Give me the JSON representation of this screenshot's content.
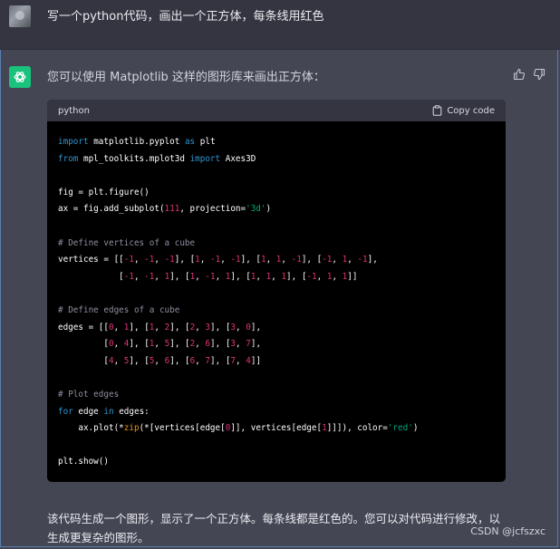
{
  "user_message": "写一个python代码，画出一个正方体，每条线用红色",
  "assistant": {
    "intro": "您可以使用 Matplotlib 这样的图形库来画出正方体：",
    "code_language": "python",
    "copy_label": "Copy code",
    "code_lines": [
      [
        {
          "t": "import",
          "c": "kw"
        },
        {
          "t": " matplotlib.pyplot "
        },
        {
          "t": "as",
          "c": "kw"
        },
        {
          "t": " plt"
        }
      ],
      [
        {
          "t": "from",
          "c": "kw"
        },
        {
          "t": " mpl_toolkits.mplot3d "
        },
        {
          "t": "import",
          "c": "kw"
        },
        {
          "t": " Axes3D"
        }
      ],
      [],
      [
        {
          "t": "fig = plt.figure()"
        }
      ],
      [
        {
          "t": "ax = fig.add_subplot("
        },
        {
          "t": "111",
          "c": "num"
        },
        {
          "t": ", projection="
        },
        {
          "t": "'3d'",
          "c": "str"
        },
        {
          "t": ")"
        }
      ],
      [],
      [
        {
          "t": "# Define vertices of a cube",
          "c": "cm"
        }
      ],
      [
        {
          "t": "vertices = [["
        },
        {
          "t": "-1",
          "c": "num"
        },
        {
          "t": ", "
        },
        {
          "t": "-1",
          "c": "num"
        },
        {
          "t": ", "
        },
        {
          "t": "-1",
          "c": "num"
        },
        {
          "t": "], ["
        },
        {
          "t": "1",
          "c": "num"
        },
        {
          "t": ", "
        },
        {
          "t": "-1",
          "c": "num"
        },
        {
          "t": ", "
        },
        {
          "t": "-1",
          "c": "num"
        },
        {
          "t": "], ["
        },
        {
          "t": "1",
          "c": "num"
        },
        {
          "t": ", "
        },
        {
          "t": "1",
          "c": "num"
        },
        {
          "t": ", "
        },
        {
          "t": "-1",
          "c": "num"
        },
        {
          "t": "], ["
        },
        {
          "t": "-1",
          "c": "num"
        },
        {
          "t": ", "
        },
        {
          "t": "1",
          "c": "num"
        },
        {
          "t": ", "
        },
        {
          "t": "-1",
          "c": "num"
        },
        {
          "t": "],"
        }
      ],
      [
        {
          "t": "            ["
        },
        {
          "t": "-1",
          "c": "num"
        },
        {
          "t": ", "
        },
        {
          "t": "-1",
          "c": "num"
        },
        {
          "t": ", "
        },
        {
          "t": "1",
          "c": "num"
        },
        {
          "t": "], ["
        },
        {
          "t": "1",
          "c": "num"
        },
        {
          "t": ", "
        },
        {
          "t": "-1",
          "c": "num"
        },
        {
          "t": ", "
        },
        {
          "t": "1",
          "c": "num"
        },
        {
          "t": "], ["
        },
        {
          "t": "1",
          "c": "num"
        },
        {
          "t": ", "
        },
        {
          "t": "1",
          "c": "num"
        },
        {
          "t": ", "
        },
        {
          "t": "1",
          "c": "num"
        },
        {
          "t": "], ["
        },
        {
          "t": "-1",
          "c": "num"
        },
        {
          "t": ", "
        },
        {
          "t": "1",
          "c": "num"
        },
        {
          "t": ", "
        },
        {
          "t": "1",
          "c": "num"
        },
        {
          "t": "]]"
        }
      ],
      [],
      [
        {
          "t": "# Define edges of a cube",
          "c": "cm"
        }
      ],
      [
        {
          "t": "edges = [["
        },
        {
          "t": "0",
          "c": "num"
        },
        {
          "t": ", "
        },
        {
          "t": "1",
          "c": "num"
        },
        {
          "t": "], ["
        },
        {
          "t": "1",
          "c": "num"
        },
        {
          "t": ", "
        },
        {
          "t": "2",
          "c": "num"
        },
        {
          "t": "], ["
        },
        {
          "t": "2",
          "c": "num"
        },
        {
          "t": ", "
        },
        {
          "t": "3",
          "c": "num"
        },
        {
          "t": "], ["
        },
        {
          "t": "3",
          "c": "num"
        },
        {
          "t": ", "
        },
        {
          "t": "0",
          "c": "num"
        },
        {
          "t": "],"
        }
      ],
      [
        {
          "t": "         ["
        },
        {
          "t": "0",
          "c": "num"
        },
        {
          "t": ", "
        },
        {
          "t": "4",
          "c": "num"
        },
        {
          "t": "], ["
        },
        {
          "t": "1",
          "c": "num"
        },
        {
          "t": ", "
        },
        {
          "t": "5",
          "c": "num"
        },
        {
          "t": "], ["
        },
        {
          "t": "2",
          "c": "num"
        },
        {
          "t": ", "
        },
        {
          "t": "6",
          "c": "num"
        },
        {
          "t": "], ["
        },
        {
          "t": "3",
          "c": "num"
        },
        {
          "t": ", "
        },
        {
          "t": "7",
          "c": "num"
        },
        {
          "t": "],"
        }
      ],
      [
        {
          "t": "         ["
        },
        {
          "t": "4",
          "c": "num"
        },
        {
          "t": ", "
        },
        {
          "t": "5",
          "c": "num"
        },
        {
          "t": "], ["
        },
        {
          "t": "5",
          "c": "num"
        },
        {
          "t": ", "
        },
        {
          "t": "6",
          "c": "num"
        },
        {
          "t": "], ["
        },
        {
          "t": "6",
          "c": "num"
        },
        {
          "t": ", "
        },
        {
          "t": "7",
          "c": "num"
        },
        {
          "t": "], ["
        },
        {
          "t": "7",
          "c": "num"
        },
        {
          "t": ", "
        },
        {
          "t": "4",
          "c": "num"
        },
        {
          "t": "]]"
        }
      ],
      [],
      [
        {
          "t": "# Plot edges",
          "c": "cm"
        }
      ],
      [
        {
          "t": "for",
          "c": "kw"
        },
        {
          "t": " edge "
        },
        {
          "t": "in",
          "c": "kw"
        },
        {
          "t": " edges:"
        }
      ],
      [
        {
          "t": "    ax.plot(*"
        },
        {
          "t": "zip",
          "c": "bi"
        },
        {
          "t": "(*[vertices[edge["
        },
        {
          "t": "0",
          "c": "num"
        },
        {
          "t": "]], vertices[edge["
        },
        {
          "t": "1",
          "c": "num"
        },
        {
          "t": "]]]), color="
        },
        {
          "t": "'red'",
          "c": "str"
        },
        {
          "t": ")"
        }
      ],
      [],
      [
        {
          "t": "plt.show()"
        }
      ]
    ],
    "closing": "该代码生成一个图形，显示了一个正方体。每条线都是红色的。您可以对代码进行修改，以生成更复杂的图形。"
  },
  "watermark": "CSDN @jcfszxc"
}
